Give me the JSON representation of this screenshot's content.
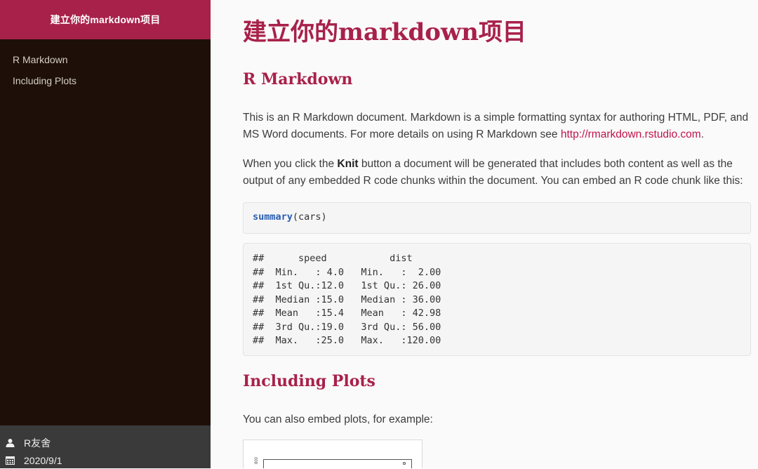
{
  "sidebar": {
    "title": "建立你的markdown项目",
    "toc": [
      {
        "label": "R Markdown"
      },
      {
        "label": "Including Plots"
      }
    ],
    "footer": {
      "author": "R友舍",
      "date": "2020/9/1",
      "author_icon": "user-icon",
      "date_icon": "calendar-icon"
    }
  },
  "main": {
    "title": "建立你的markdown项目",
    "section1": {
      "heading": "R Markdown",
      "para1_text": "This is an R Markdown document. Markdown is a simple formatting syntax for authoring HTML, PDF, and MS Word documents. For more details on using R Markdown see ",
      "para1_link": "http://rmarkdown.rstudio.com",
      "para1_end": ".",
      "para2_before": "When you click the ",
      "para2_bold": "Knit",
      "para2_after": " button a document will be generated that includes both content as well as the output of any embedded R code chunks within the document. You can embed an R code chunk like this:",
      "code_fn": "summary",
      "code_args": "(cars)",
      "output": "##      speed           dist       \n##  Min.   : 4.0   Min.   :  2.00  \n##  1st Qu.:12.0   1st Qu.: 26.00  \n##  Median :15.0   Median : 36.00  \n##  Mean   :15.4   Mean   : 42.98  \n##  3rd Qu.:19.0   3rd Qu.: 56.00  \n##  Max.   :25.0   Max.   :120.00  "
    },
    "section2": {
      "heading": "Including Plots",
      "para": "You can also embed plots, for example:",
      "plot_ylabel": "800"
    }
  },
  "colors": {
    "accent": "#a8214a",
    "sidebar_bg": "#1e1008",
    "footer_bg": "#3a3a3a",
    "link": "#c0134a"
  }
}
